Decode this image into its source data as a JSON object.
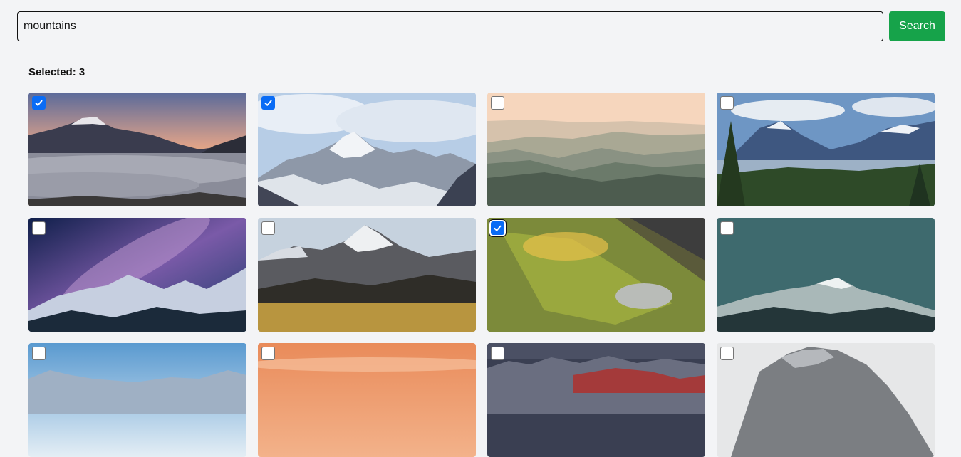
{
  "search": {
    "value": "mountains",
    "placeholder": "",
    "button_label": "Search"
  },
  "selection": {
    "label": "Selected: 3"
  },
  "colors": {
    "button": "#16a34a",
    "checkbox_checked": "#0a6cf5",
    "background": "#f3f4f6"
  },
  "images": [
    {
      "scene": "sunset-peaks-above-clouds",
      "checked": true
    },
    {
      "scene": "snowy-peaks-blue-sky",
      "checked": true
    },
    {
      "scene": "hazy-layered-ridges",
      "checked": false
    },
    {
      "scene": "valley-with-pine-forest",
      "checked": false
    },
    {
      "scene": "milky-way-over-snow-peaks",
      "checked": false
    },
    {
      "scene": "snow-peak-over-meadow",
      "checked": false
    },
    {
      "scene": "mossy-slope-sunlight",
      "checked": true,
      "focused": true
    },
    {
      "scene": "teal-misty-peaks",
      "checked": false
    },
    {
      "scene": "blue-sky-distant-peaks",
      "checked": false
    },
    {
      "scene": "orange-sunset-sky",
      "checked": false
    },
    {
      "scene": "red-rocky-range-dusk",
      "checked": false
    },
    {
      "scene": "grey-rocky-summit",
      "checked": false
    }
  ]
}
